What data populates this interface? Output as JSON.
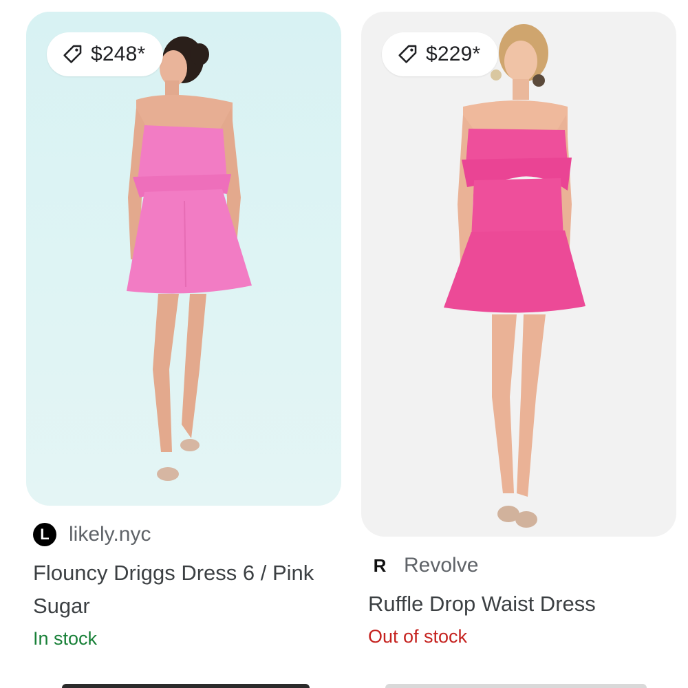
{
  "products": [
    {
      "price": "$248*",
      "source": "likely.nyc",
      "logo_letter": "L",
      "title": "Flouncy Driggs Dress 6 / Pink Sugar",
      "stock": "In stock"
    },
    {
      "price": "$229*",
      "source": "Revolve",
      "logo_letter": "R",
      "title": "Ruffle Drop Waist Dress",
      "stock": "Out of stock"
    }
  ],
  "colors": {
    "in_stock": "#188038",
    "out_of_stock": "#c5221f",
    "dress_left": "#f27cc4",
    "dress_right": "#ee4f9b"
  }
}
